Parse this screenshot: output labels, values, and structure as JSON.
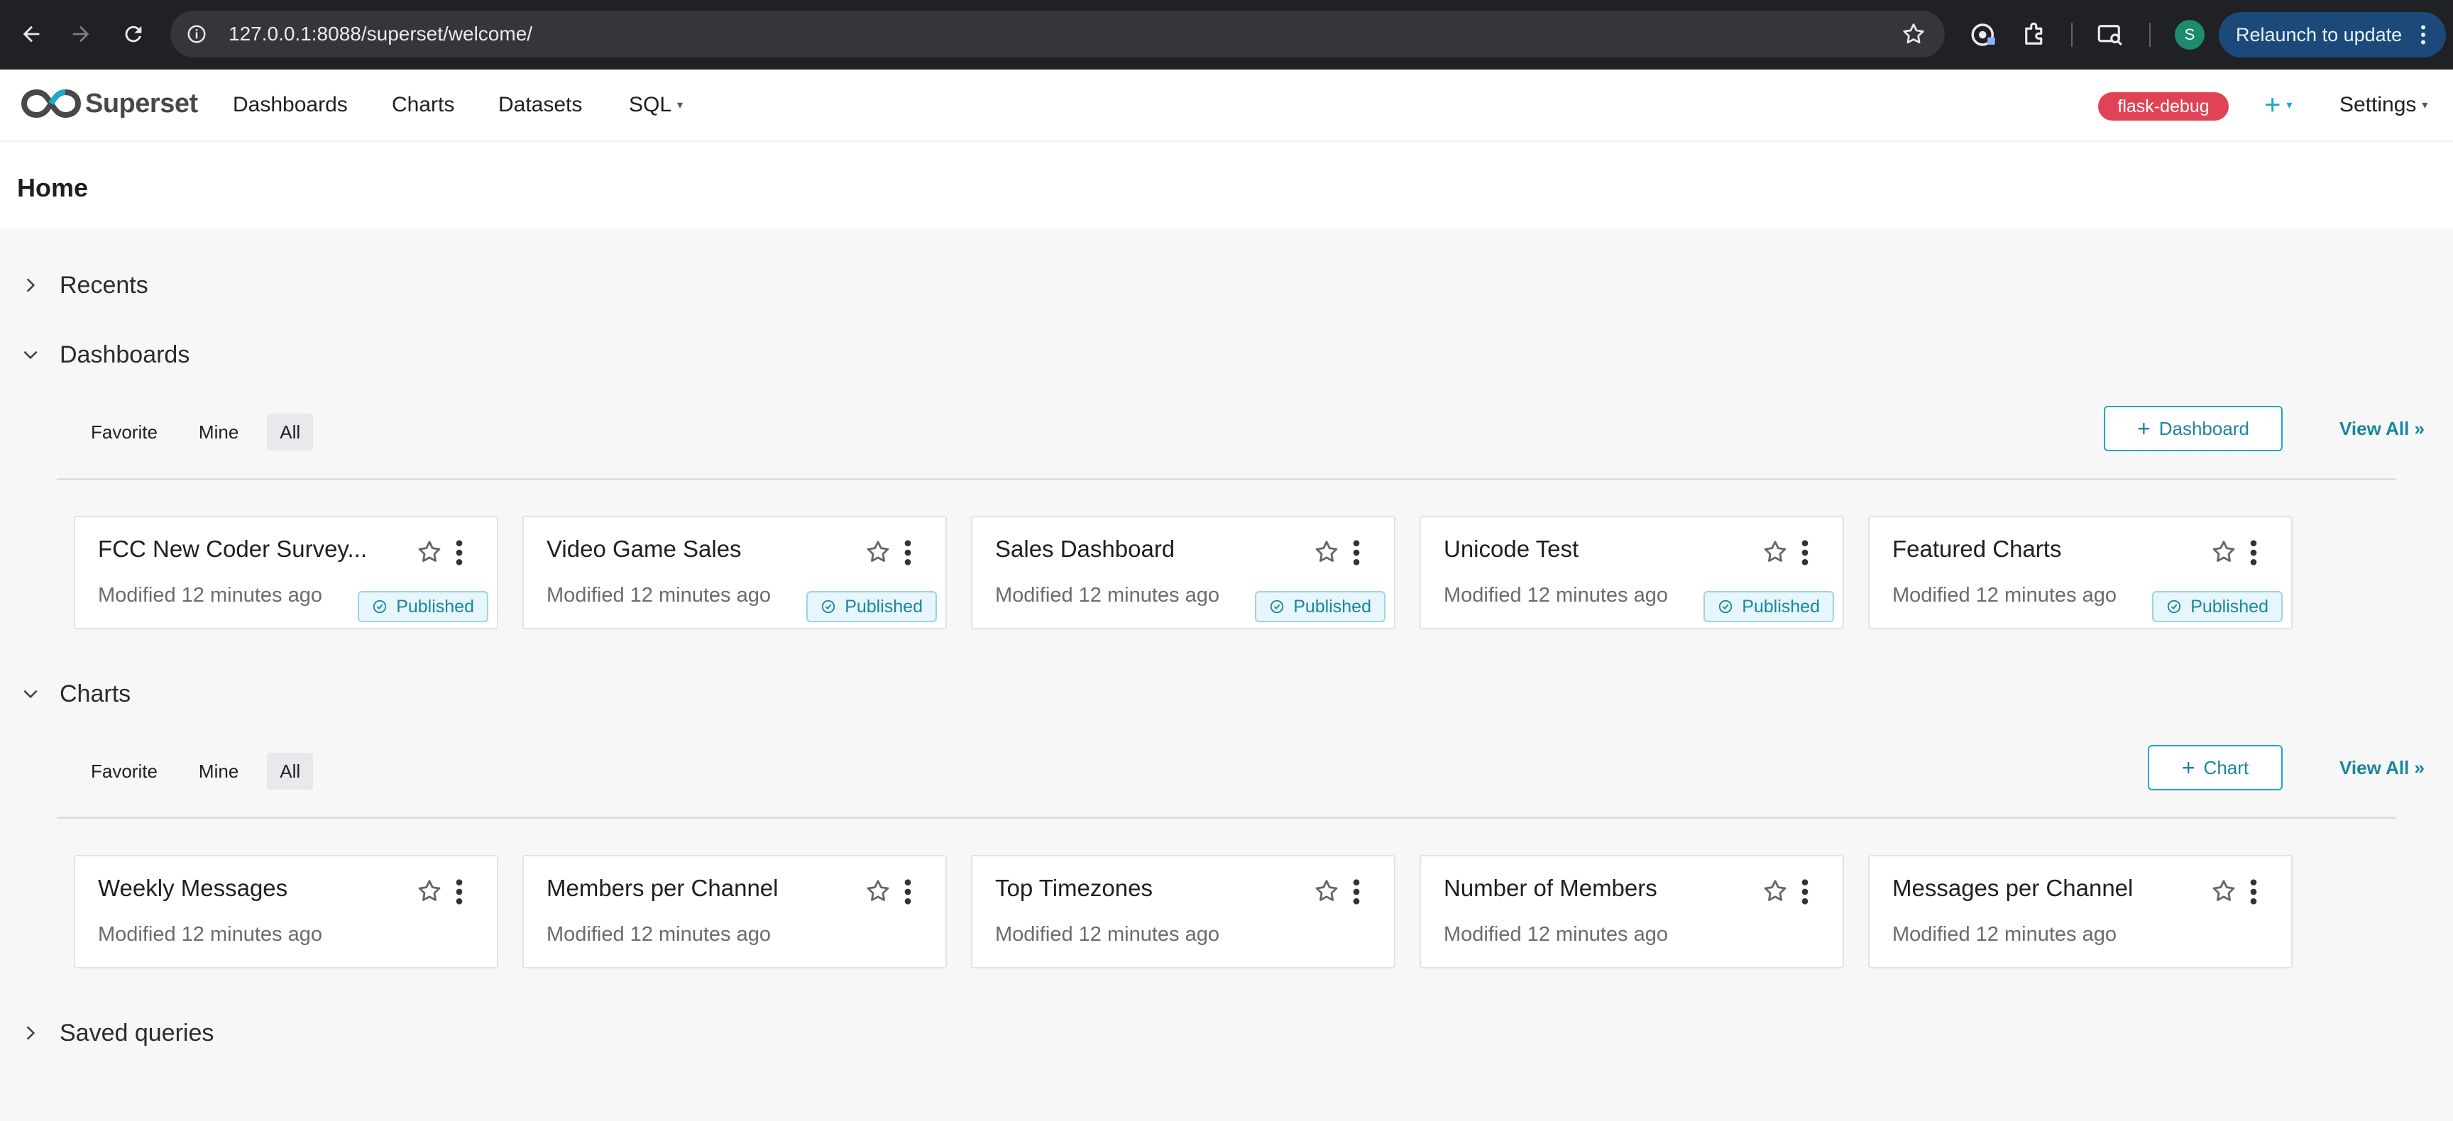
{
  "browser": {
    "url": "127.0.0.1:8088/superset/welcome/",
    "profile_initial": "S",
    "relaunch_label": "Relaunch to update"
  },
  "app": {
    "logo_text": "Superset",
    "nav": [
      "Dashboards",
      "Charts",
      "Datasets",
      "SQL"
    ],
    "env_badge": "flask-debug",
    "plus_label": "+",
    "settings_label": "Settings"
  },
  "page": {
    "title": "Home"
  },
  "recents": {
    "label": "Recents",
    "expanded": false
  },
  "dashboards": {
    "label": "Dashboards",
    "expanded": true,
    "filters": [
      "Favorite",
      "Mine",
      "All"
    ],
    "active_filter": "All",
    "add_label": "Dashboard",
    "view_all_label": "View All »",
    "items": [
      {
        "title": "FCC New Coder Survey...",
        "modified": "Modified 12 minutes ago",
        "status": "Published"
      },
      {
        "title": "Video Game Sales",
        "modified": "Modified 12 minutes ago",
        "status": "Published"
      },
      {
        "title": "Sales Dashboard",
        "modified": "Modified 12 minutes ago",
        "status": "Published"
      },
      {
        "title": "Unicode Test",
        "modified": "Modified 12 minutes ago",
        "status": "Published"
      },
      {
        "title": "Featured Charts",
        "modified": "Modified 12 minutes ago",
        "status": "Published"
      }
    ]
  },
  "charts": {
    "label": "Charts",
    "expanded": true,
    "filters": [
      "Favorite",
      "Mine",
      "All"
    ],
    "active_filter": "All",
    "add_label": "Chart",
    "view_all_label": "View All »",
    "items": [
      {
        "title": "Weekly Messages",
        "modified": "Modified 12 minutes ago"
      },
      {
        "title": "Members per Channel",
        "modified": "Modified 12 minutes ago"
      },
      {
        "title": "Top Timezones",
        "modified": "Modified 12 minutes ago"
      },
      {
        "title": "Number of Members",
        "modified": "Modified 12 minutes ago"
      },
      {
        "title": "Messages per Channel",
        "modified": "Modified 12 minutes ago"
      }
    ]
  },
  "saved_queries": {
    "label": "Saved queries",
    "expanded": false
  },
  "colors": {
    "accent": "#20a7c9",
    "accent_text": "#1a85a0",
    "env_badge": "#e04355"
  }
}
